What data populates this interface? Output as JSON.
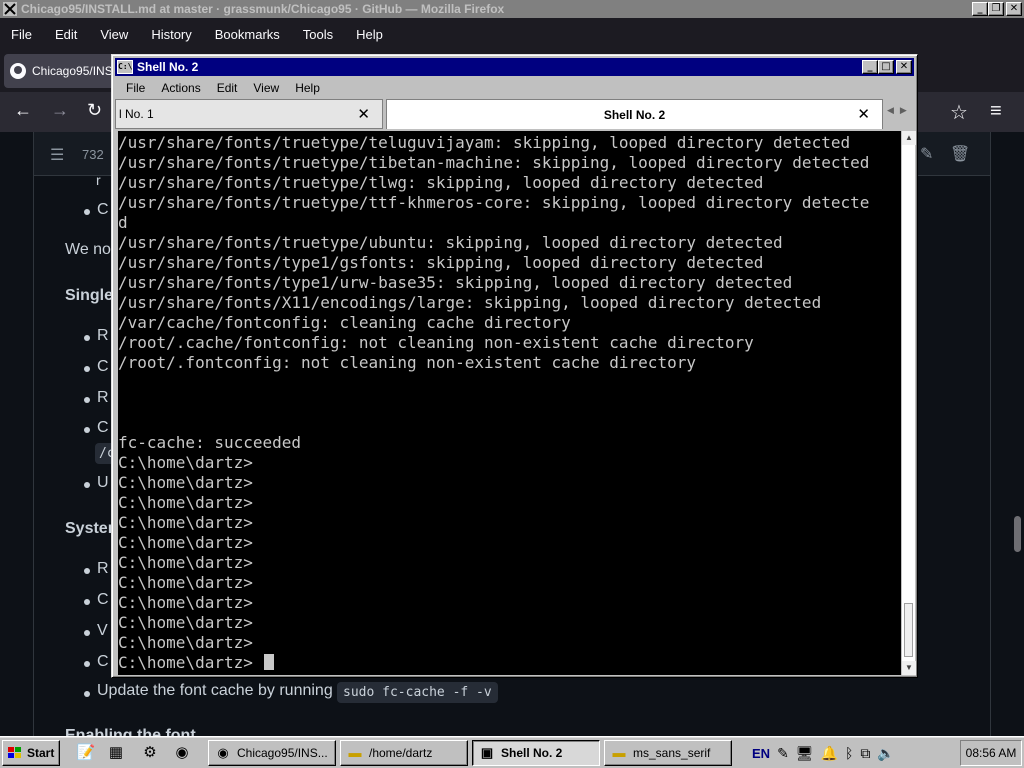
{
  "firefox": {
    "title": "Chicago95/INSTALL.md at master · grassmunk/Chicago95 · GitHub — Mozilla Firefox",
    "menu": [
      "File",
      "Edit",
      "View",
      "History",
      "Bookmarks",
      "Tools",
      "Help"
    ],
    "tab_label": "Chicago95/INS",
    "lines_count": "732",
    "icons": {
      "back": "arrow-left-icon",
      "forward": "arrow-right-icon",
      "reload": "reload-icon",
      "bookmark": "star-icon",
      "menu": "hamburger-icon"
    }
  },
  "github_page": {
    "visible_fragments": [
      "r",
      "C",
      "We no",
      "Single",
      "R",
      "C",
      "R",
      "C",
      "/c",
      "U",
      "System",
      "R",
      "C",
      "V",
      "C"
    ],
    "update_text": "Update the font cache by running",
    "update_code": "sudo fc-cache -f -v",
    "partial_heading": "Enabling the font"
  },
  "shell": {
    "title": "Shell No. 2",
    "menu": [
      "File",
      "Actions",
      "Edit",
      "View",
      "Help"
    ],
    "tabs": [
      {
        "label": "l No. 1",
        "active": false
      },
      {
        "label": "Shell No. 2",
        "active": true
      }
    ],
    "output_lines": [
      "/usr/share/fonts/truetype/teluguvijayam: skipping, looped directory detected",
      "/usr/share/fonts/truetype/tibetan-machine: skipping, looped directory detected",
      "/usr/share/fonts/truetype/tlwg: skipping, looped directory detected",
      "/usr/share/fonts/truetype/ttf-khmeros-core: skipping, looped directory detecte",
      "d",
      "/usr/share/fonts/truetype/ubuntu: skipping, looped directory detected",
      "/usr/share/fonts/type1/gsfonts: skipping, looped directory detected",
      "/usr/share/fonts/type1/urw-base35: skipping, looped directory detected",
      "/usr/share/fonts/X11/encodings/large: skipping, looped directory detected",
      "/var/cache/fontconfig: cleaning cache directory",
      "/root/.cache/fontconfig: not cleaning non-existent cache directory",
      "/root/.fontconfig: not cleaning non-existent cache directory",
      "",
      "",
      "",
      "fc-cache: succeeded",
      "C:\\home\\dartz>",
      "C:\\home\\dartz>",
      "C:\\home\\dartz>",
      "C:\\home\\dartz>",
      "C:\\home\\dartz>",
      "C:\\home\\dartz>",
      "C:\\home\\dartz>",
      "C:\\home\\dartz>",
      "C:\\home\\dartz>",
      "C:\\home\\dartz>",
      "C:\\home\\dartz> "
    ]
  },
  "taskbar": {
    "start_label": "Start",
    "quicklaunch": [
      "notepad-icon",
      "screensaver-icon",
      "settings-icon",
      "firefox-icon"
    ],
    "tasks": [
      {
        "label": "Chicago95/INS...",
        "icon": "firefox-icon",
        "active": false
      },
      {
        "label": "/home/dartz",
        "icon": "folder-icon",
        "active": false
      },
      {
        "label": "Shell No. 2",
        "icon": "terminal-icon",
        "active": true
      },
      {
        "label": "ms_sans_serif",
        "icon": "folder-icon",
        "active": false
      }
    ],
    "tray_lang": "EN",
    "clock": "08:56 AM"
  },
  "colors": {
    "win95_face": "#c0c0c0",
    "title_active": "#000080",
    "title_inactive": "#808080",
    "terminal_bg": "#000000",
    "terminal_fg": "#c8c8c8",
    "github_bg": "#0d1117"
  }
}
